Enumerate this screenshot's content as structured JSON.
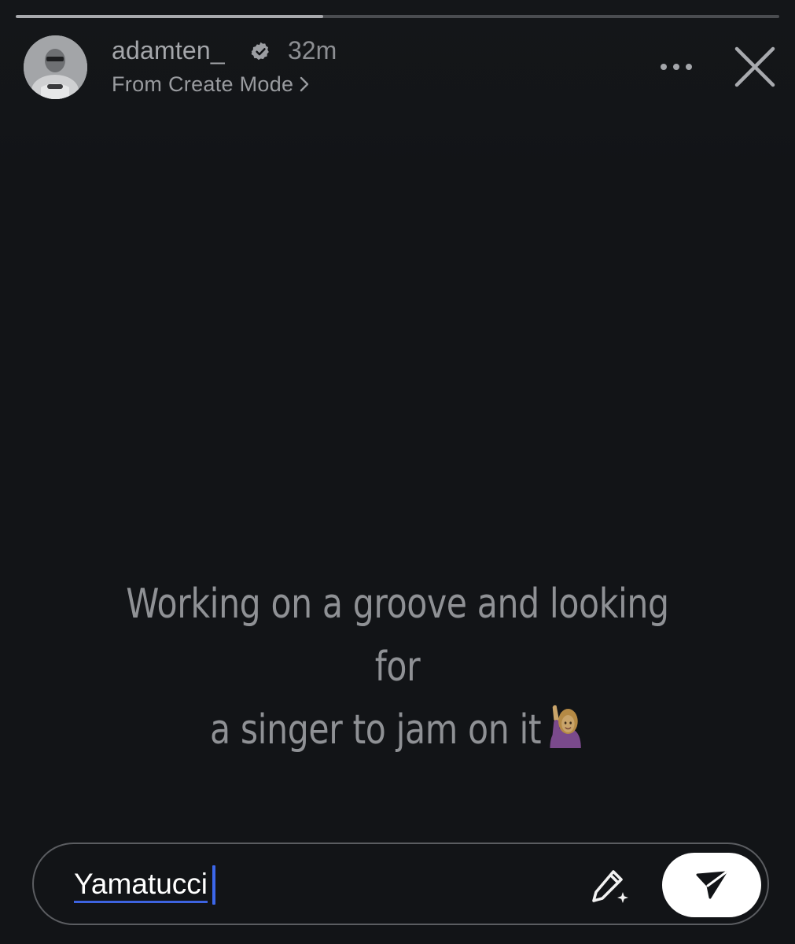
{
  "story": {
    "progress": 0.403,
    "author": {
      "username": "adamten_",
      "verified": true,
      "time_ago": "32m",
      "subtitle": "From Create Mode"
    },
    "text_line1": "Working on a groove and looking for",
    "text_line2": "a singer to jam on it",
    "emoji": "person-raising-hand-emoji"
  },
  "reply": {
    "value": "Yamatucci",
    "caret_color": "#3c67ea"
  },
  "icons": {
    "more": "more-dots-icon",
    "close": "close-icon",
    "edit": "pencil-sparkle-icon",
    "send": "send-icon",
    "verified": "verified-badge-icon"
  },
  "colors": {
    "background": "#121417",
    "text": "#8f9195",
    "send_button": "#ffffff"
  }
}
